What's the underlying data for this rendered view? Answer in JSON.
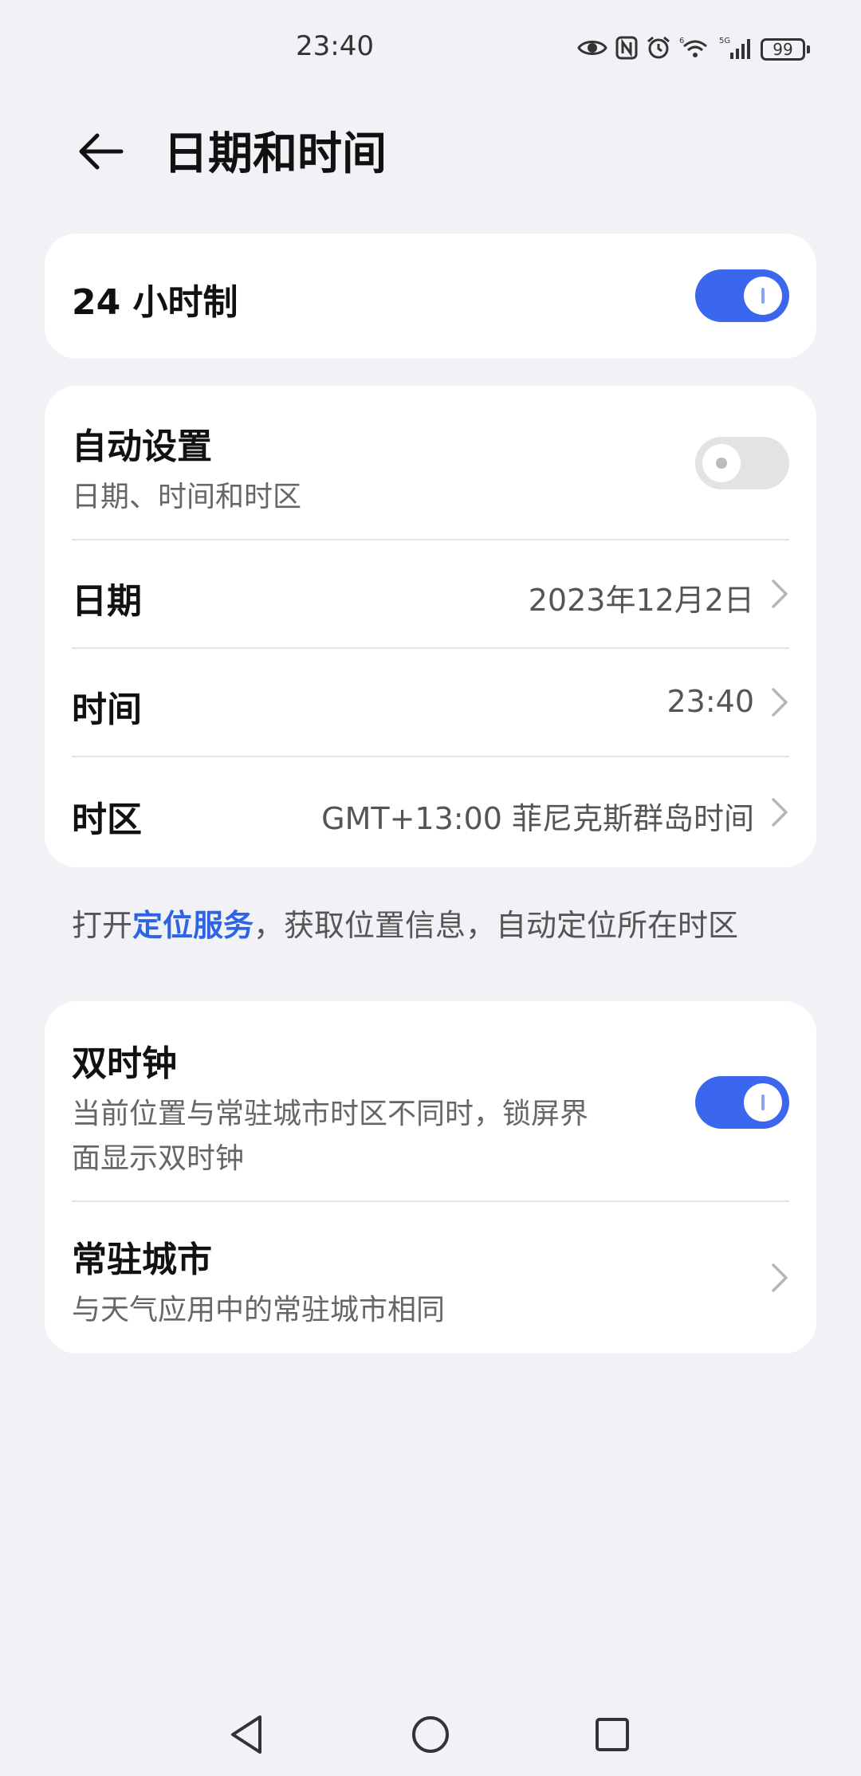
{
  "status": {
    "time": "23:40",
    "battery": "99",
    "network": "5G"
  },
  "header": {
    "title": "日期和时间"
  },
  "hour24": {
    "label": "24 小时制",
    "enabled": true
  },
  "auto": {
    "title": "自动设置",
    "subtitle": "日期、时间和时区",
    "enabled": false
  },
  "date": {
    "label": "日期",
    "value": "2023年12月2日"
  },
  "time": {
    "label": "时间",
    "value": "23:40"
  },
  "timezone": {
    "label": "时区",
    "value": "GMT+13:00 菲尼克斯群岛时间"
  },
  "hint": {
    "prefix": "打开",
    "link": "定位服务",
    "suffix": "，获取位置信息，自动定位所在时区"
  },
  "dual_clock": {
    "title": "双时钟",
    "subtitle_line1": "当前位置与常驻城市时区不同时，锁屏界",
    "subtitle_line2": "面显示双时钟",
    "enabled": true
  },
  "home_city": {
    "title": "常驻城市",
    "subtitle": "与天气应用中的常驻城市相同"
  },
  "colors": {
    "accent": "#3b67ee",
    "link": "#2f63e6",
    "background": "#f1f2f6"
  },
  "icons": [
    "eye-icon",
    "nfc-icon",
    "alarm-icon",
    "wifi-icon",
    "signal-icon",
    "battery-icon",
    "back-arrow-icon",
    "chevron-right-icon",
    "nav-back-icon",
    "nav-home-icon",
    "nav-recents-icon"
  ]
}
